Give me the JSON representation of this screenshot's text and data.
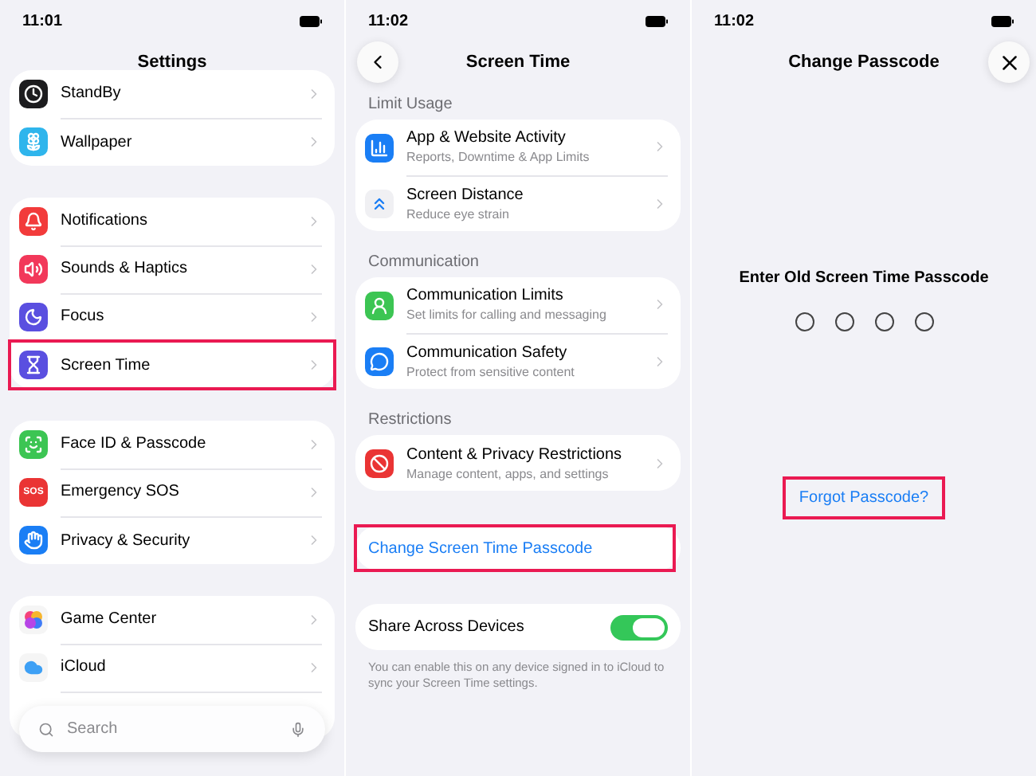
{
  "screens": [
    {
      "time": "11:01",
      "title": "Settings",
      "groups": [
        {
          "rows": [
            {
              "label": "StandBy",
              "color": "#1c1c1e",
              "highlighted": false
            },
            {
              "label": "Wallpaper",
              "color": "#2fb5ec",
              "highlighted": false
            }
          ]
        },
        {
          "rows": [
            {
              "label": "Notifications",
              "color": "#f23b3b",
              "highlighted": false
            },
            {
              "label": "Sounds & Haptics",
              "color": "#f2385a",
              "highlighted": false
            },
            {
              "label": "Focus",
              "color": "#5a4fe0",
              "highlighted": false
            },
            {
              "label": "Screen Time",
              "color": "#5a4fe0",
              "highlighted": true
            }
          ]
        },
        {
          "rows": [
            {
              "label": "Face ID & Passcode",
              "color": "#3cc553",
              "highlighted": false
            },
            {
              "label": "Emergency SOS",
              "color": "#ea3434",
              "badge": "SOS",
              "highlighted": false
            },
            {
              "label": "Privacy & Security",
              "color": "#1a7ef5",
              "highlighted": false
            }
          ]
        },
        {
          "rows": [
            {
              "label": "Game Center",
              "color": "#f5f5f5",
              "highlighted": false
            },
            {
              "label": "iCloud",
              "color": "#f5f5f5",
              "highlighted": false
            }
          ]
        }
      ],
      "search": {
        "placeholder": "Search"
      }
    },
    {
      "time": "11:02",
      "title": "Screen Time",
      "sections": [
        {
          "header": "Limit Usage",
          "rows": [
            {
              "label": "App & Website Activity",
              "detail": "Reports, Downtime & App Limits",
              "color": "#1a7ef5"
            },
            {
              "label": "Screen Distance",
              "detail": "Reduce eye strain",
              "color": "#f0f0f3"
            }
          ]
        },
        {
          "header": "Communication",
          "rows": [
            {
              "label": "Communication Limits",
              "detail": "Set limits for calling and messaging",
              "color": "#3cc553"
            },
            {
              "label": "Communication Safety",
              "detail": "Protect from sensitive content",
              "color": "#1a7ef5"
            }
          ]
        },
        {
          "header": "Restrictions",
          "rows": [
            {
              "label": "Content & Privacy Restrictions",
              "detail": "Manage content, apps, and settings",
              "color": "#ea3434"
            }
          ]
        }
      ],
      "change_passcode": {
        "label": "Change Screen Time Passcode",
        "highlighted": true
      },
      "share": {
        "label": "Share Across Devices",
        "on": true,
        "footnote": "You can enable this on any device signed in to iCloud to sync your Screen Time settings."
      }
    },
    {
      "time": "11:02",
      "title": "Change Passcode",
      "prompt": "Enter Old Screen Time Passcode",
      "dots": [
        {
          "filled": false
        },
        {
          "filled": false
        },
        {
          "filled": false
        },
        {
          "filled": false
        }
      ],
      "forgot": {
        "label": "Forgot Passcode?",
        "highlighted": true
      }
    }
  ]
}
